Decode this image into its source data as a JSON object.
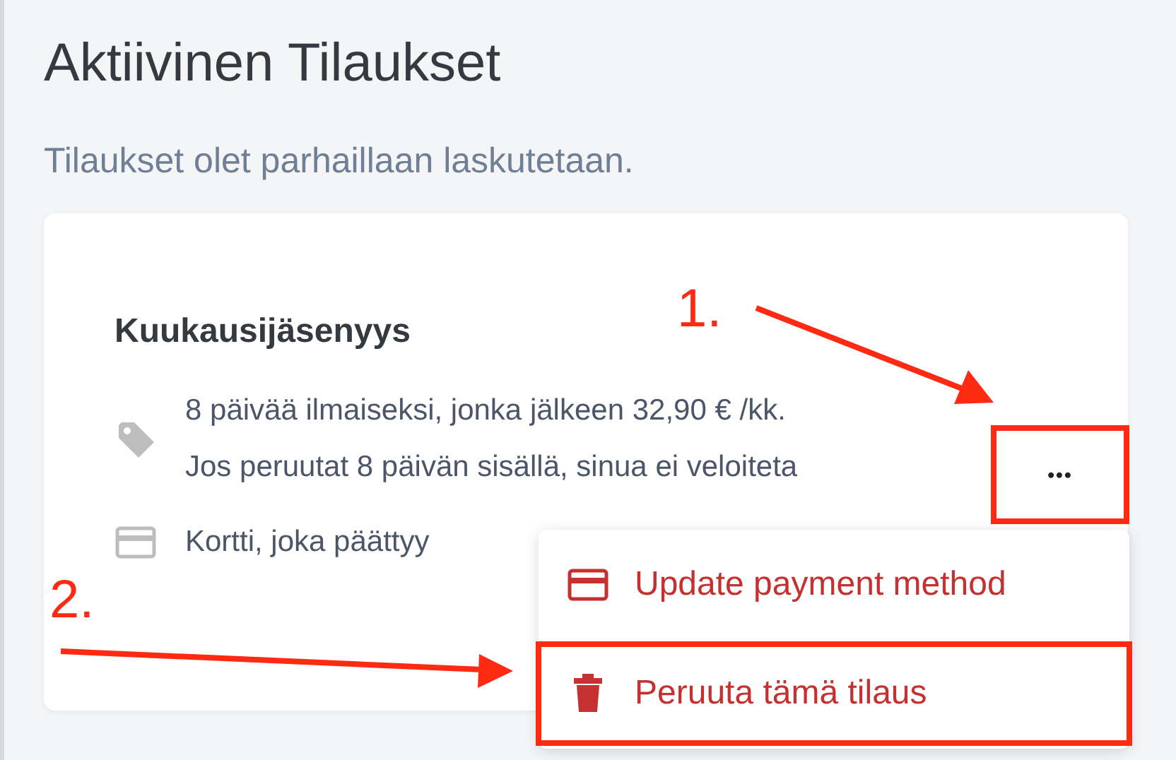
{
  "page": {
    "title": "Aktiivinen Tilaukset",
    "subtitle": "Tilaukset olet parhaillaan laskutetaan."
  },
  "subscription": {
    "name": "Kuukausijäsenyys",
    "details": [
      {
        "kind": "price",
        "lines": [
          "8 päivää ilmaiseksi, jonka jälkeen 32,90 € /kk.",
          "Jos peruutat 8 päivän sisällä, sinua ei veloiteta"
        ]
      },
      {
        "kind": "card",
        "lines": [
          "Kortti, joka päättyy"
        ]
      }
    ],
    "more_button": {
      "label": "•••",
      "highlighted": true
    }
  },
  "menu": {
    "items": [
      {
        "kind": "card",
        "label": "Update payment method",
        "highlighted": false
      },
      {
        "kind": "trash",
        "label": "Peruuta tämä tilaus",
        "highlighted": true
      }
    ]
  },
  "annotations": [
    {
      "label": "1."
    },
    {
      "label": "2."
    }
  ]
}
